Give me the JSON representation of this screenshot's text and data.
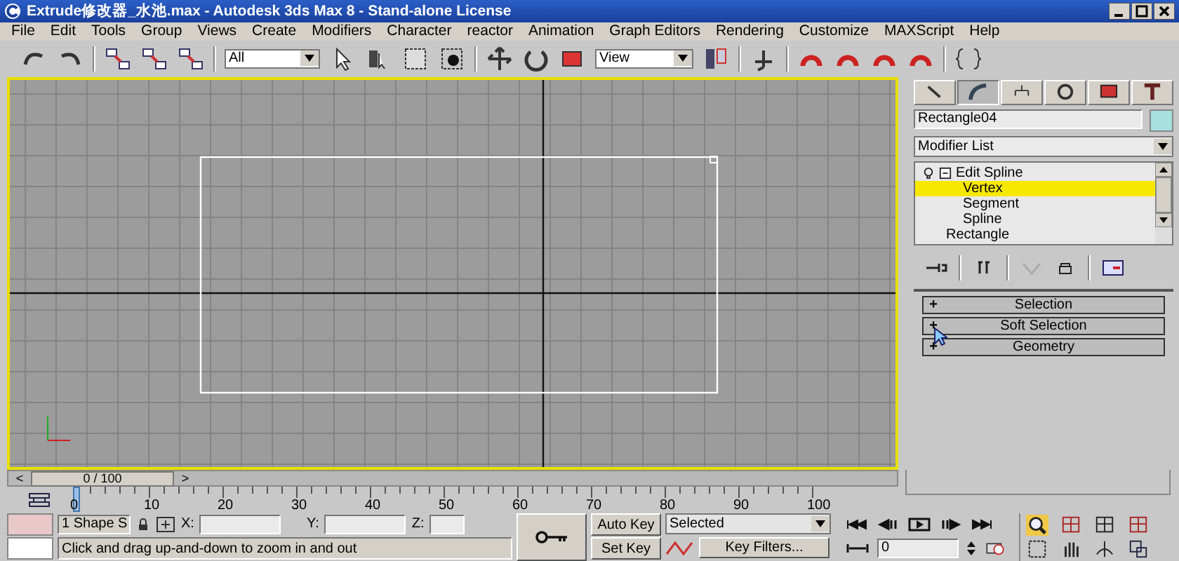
{
  "window": {
    "title": "Extrude修改器_水池.max - Autodesk 3ds Max 8  - Stand-alone License"
  },
  "menu": [
    "File",
    "Edit",
    "Tools",
    "Group",
    "Views",
    "Create",
    "Modifiers",
    "Character",
    "reactor",
    "Animation",
    "Graph Editors",
    "Rendering",
    "Customize",
    "MAXScript",
    "Help"
  ],
  "toolbar": {
    "selection_filter": "All",
    "reference_coordinates": "View"
  },
  "command_panel": {
    "tabs": [
      {
        "selected": false
      },
      {
        "selected": true
      },
      {
        "selected": false
      },
      {
        "selected": false
      },
      {
        "selected": false
      },
      {
        "selected": false
      }
    ],
    "object_name": "Rectangle04",
    "modifier_list": "Modifier List",
    "stack": [
      {
        "label": "Edit Spline",
        "expanded": true,
        "selected": false,
        "children": [
          {
            "label": "Vertex",
            "selected": true
          },
          {
            "label": "Segment",
            "selected": false
          },
          {
            "label": "Spline",
            "selected": false
          }
        ]
      },
      {
        "label": "Rectangle",
        "selected": false
      }
    ],
    "rollouts": [
      {
        "sign": "+",
        "label": "Selection"
      },
      {
        "sign": "+",
        "label": "Soft Selection"
      },
      {
        "sign": "+",
        "label": "Geometry"
      }
    ]
  },
  "time_slider": {
    "prev": "<",
    "position": "0 / 100",
    "next": ">"
  },
  "timeline": {
    "ticks": [
      "0",
      "10",
      "20",
      "30",
      "40",
      "50",
      "60",
      "70",
      "80",
      "90",
      "100"
    ]
  },
  "status": {
    "selection": "1 Shape S",
    "x_label": "X:",
    "y_label": "Y:",
    "z_label": "Z:",
    "prompt": "Click and drag up-and-down to zoom in and out"
  },
  "animation": {
    "auto_key": "Auto Key",
    "set_key": "Set Key",
    "key_mode": "Selected",
    "key_filters": "Key Filters...",
    "frame": "0"
  }
}
